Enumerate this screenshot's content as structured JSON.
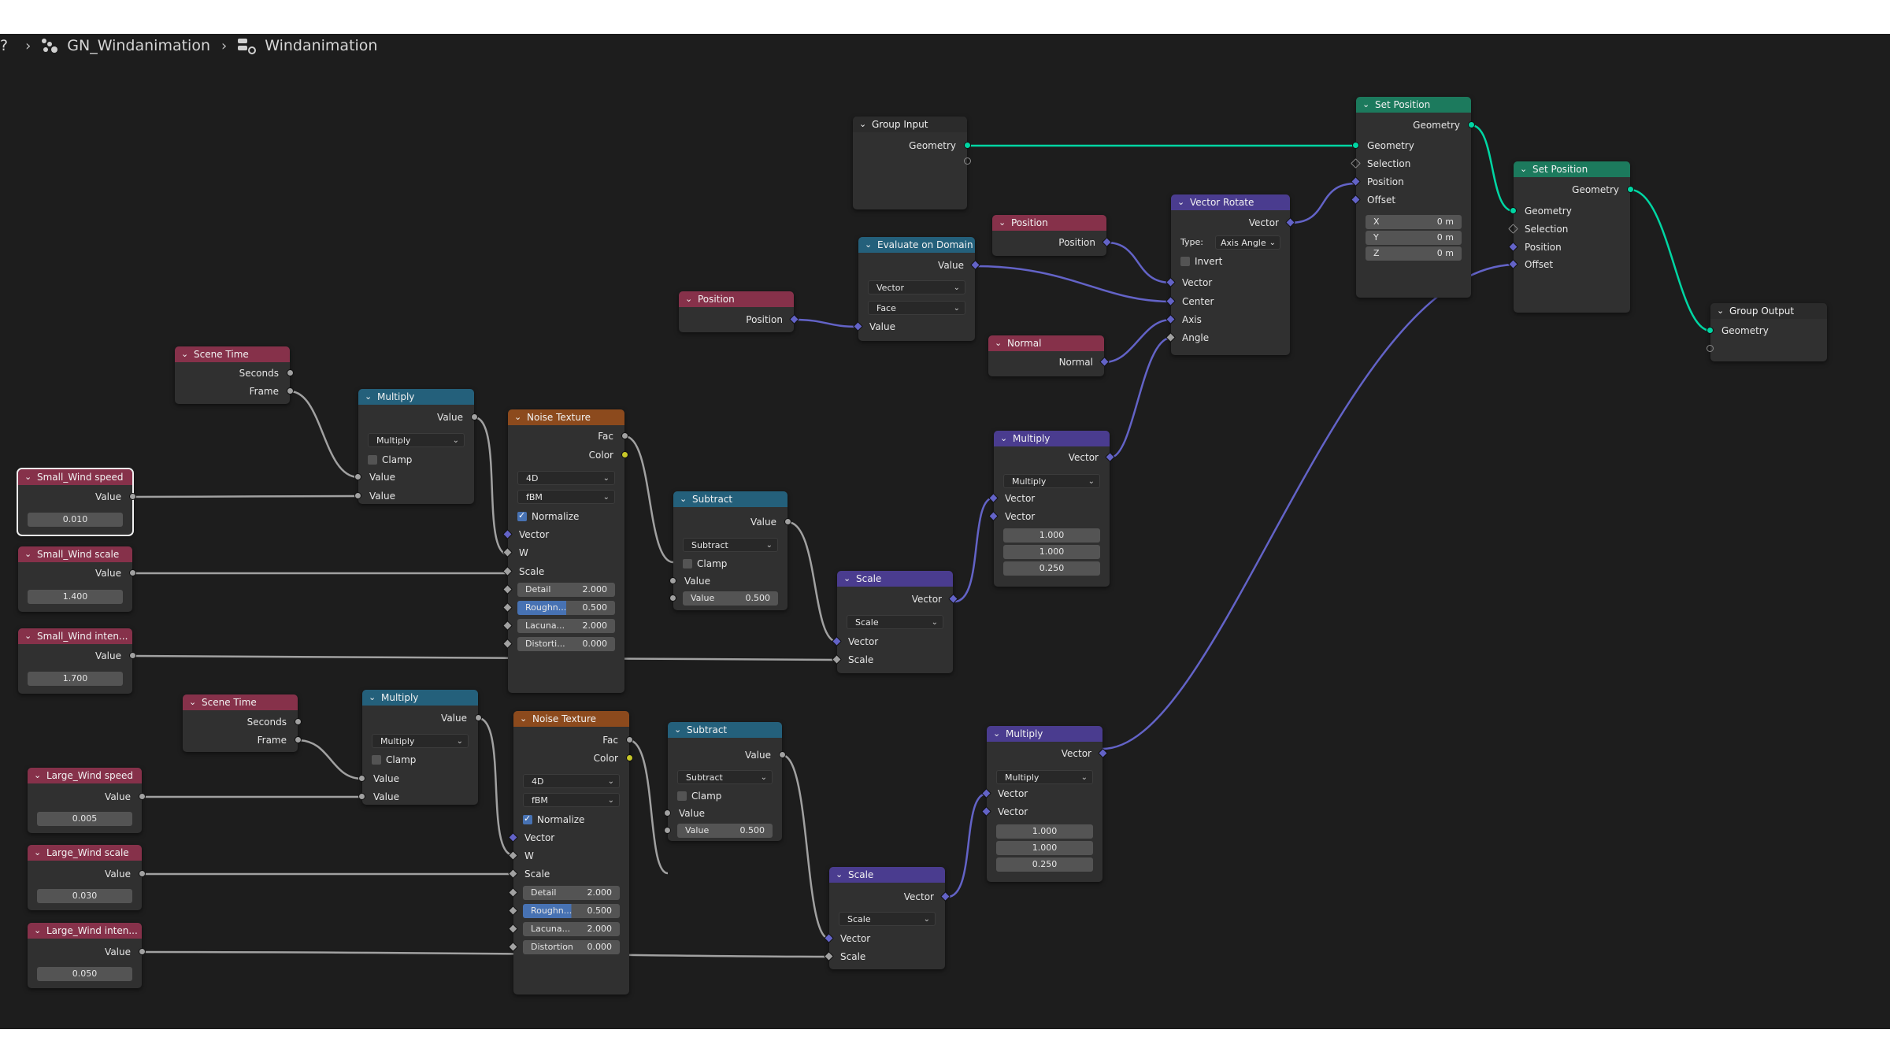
{
  "breadcrumb": {
    "lead": "?",
    "items": [
      {
        "label": "GN_Windanimation",
        "icon": "node-tree-icon"
      },
      {
        "label": "Windanimation",
        "icon": "object-data-icon"
      }
    ]
  },
  "colors": {
    "input_header": "#86314a",
    "converter_header": "#24607b",
    "texture_header": "#8c4a1d",
    "vector_header": "#4a3c8f",
    "geometry_header": "#1c7a5d",
    "geometry_wire": "#00d6a3",
    "vector_wire": "#6363c7",
    "float_wire": "#a1a1a1"
  },
  "nodes": {
    "group_input": {
      "title": "Group Input",
      "geometry": "Geometry"
    },
    "set_position_1": {
      "title": "Set Position",
      "out_geometry": "Geometry",
      "geometry": "Geometry",
      "selection": "Selection",
      "position": "Position",
      "offset": "Offset",
      "x_label": "X",
      "x_value": "0 m",
      "y_label": "Y",
      "y_value": "0 m",
      "z_label": "Z",
      "z_value": "0 m"
    },
    "set_position_2": {
      "title": "Set Position",
      "out_geometry": "Geometry",
      "geometry": "Geometry",
      "selection": "Selection",
      "position": "Position",
      "offset": "Offset"
    },
    "group_output": {
      "title": "Group Output",
      "geometry": "Geometry"
    },
    "vector_rotate": {
      "title": "Vector Rotate",
      "out_vector": "Vector",
      "type_label": "Type:",
      "type_value": "Axis Angle",
      "invert": "Invert",
      "vector": "Vector",
      "center": "Center",
      "axis": "Axis",
      "angle": "Angle"
    },
    "position_1": {
      "title": "Position",
      "position": "Position"
    },
    "position_2": {
      "title": "Position",
      "position": "Position"
    },
    "normal": {
      "title": "Normal",
      "normal": "Normal"
    },
    "evaluate_on_domain": {
      "title": "Evaluate on Domain",
      "value_out": "Value",
      "data_type": "Vector",
      "domain": "Face",
      "value_in": "Value"
    },
    "scene_time_1": {
      "title": "Scene Time",
      "seconds": "Seconds",
      "frame": "Frame"
    },
    "scene_time_2": {
      "title": "Scene Time",
      "seconds": "Seconds",
      "frame": "Frame"
    },
    "multiply_1": {
      "title": "Multiply",
      "value_out": "Value",
      "operation": "Multiply",
      "clamp": "Clamp",
      "value_a": "Value",
      "value_b": "Value"
    },
    "multiply_2": {
      "title": "Multiply",
      "value_out": "Value",
      "operation": "Multiply",
      "clamp": "Clamp",
      "value_a": "Value",
      "value_b": "Value"
    },
    "noise_1": {
      "title": "Noise Texture",
      "fac": "Fac",
      "color": "Color",
      "dimensions": "4D",
      "noise_type": "fBM",
      "normalize": "Normalize",
      "vector": "Vector",
      "w": "W",
      "scale": "Scale",
      "detail_label": "Detail",
      "detail_value": "2.000",
      "roughness_label": "Roughn...",
      "roughness_value": "0.500",
      "lacunarity_label": "Lacuna...",
      "lacunarity_value": "2.000",
      "distortion_label": "Distorti...",
      "distortion_value": "0.000"
    },
    "noise_2": {
      "title": "Noise Texture",
      "fac": "Fac",
      "color": "Color",
      "dimensions": "4D",
      "noise_type": "fBM",
      "normalize": "Normalize",
      "vector": "Vector",
      "w": "W",
      "scale": "Scale",
      "detail_label": "Detail",
      "detail_value": "2.000",
      "roughness_label": "Roughn...",
      "roughness_value": "0.500",
      "lacunarity_label": "Lacuna...",
      "lacunarity_value": "2.000",
      "distortion_label": "Distortion",
      "distortion_value": "0.000"
    },
    "subtract_1": {
      "title": "Subtract",
      "value_out": "Value",
      "operation": "Subtract",
      "clamp": "Clamp",
      "value_in": "Value",
      "value_label": "Value",
      "value_value": "0.500"
    },
    "subtract_2": {
      "title": "Subtract",
      "value_out": "Value",
      "operation": "Subtract",
      "clamp": "Clamp",
      "value_in": "Value",
      "value_label": "Value",
      "value_value": "0.500"
    },
    "scale_1": {
      "title": "Scale",
      "vector_out": "Vector",
      "operation": "Scale",
      "vector_in": "Vector",
      "scale": "Scale"
    },
    "scale_2": {
      "title": "Scale",
      "vector_out": "Vector",
      "operation": "Scale",
      "vector_in": "Vector",
      "scale": "Scale"
    },
    "vmultiply_1": {
      "title": "Multiply",
      "vector_out": "Vector",
      "operation": "Multiply",
      "vector_a": "Vector",
      "vector_b": "Vector",
      "b_x": "1.000",
      "b_y": "1.000",
      "b_z": "0.250"
    },
    "vmultiply_2": {
      "title": "Multiply",
      "vector_out": "Vector",
      "operation": "Multiply",
      "vector_a": "Vector",
      "vector_b": "Vector",
      "b_x": "1.000",
      "b_y": "1.000",
      "b_z": "0.250"
    },
    "small_wind_speed": {
      "title": "Small_Wind speed",
      "label": "Value",
      "value": "0.010"
    },
    "small_wind_scale": {
      "title": "Small_Wind scale",
      "label": "Value",
      "value": "1.400"
    },
    "small_wind_inten": {
      "title": "Small_Wind inten...",
      "label": "Value",
      "value": "1.700"
    },
    "large_wind_speed": {
      "title": "Large_Wind speed",
      "label": "Value",
      "value": "0.005"
    },
    "large_wind_scale": {
      "title": "Large_Wind scale",
      "label": "Value",
      "value": "0.030"
    },
    "large_wind_inten": {
      "title": "Large_Wind inten...",
      "label": "Value",
      "value": "0.050"
    }
  }
}
